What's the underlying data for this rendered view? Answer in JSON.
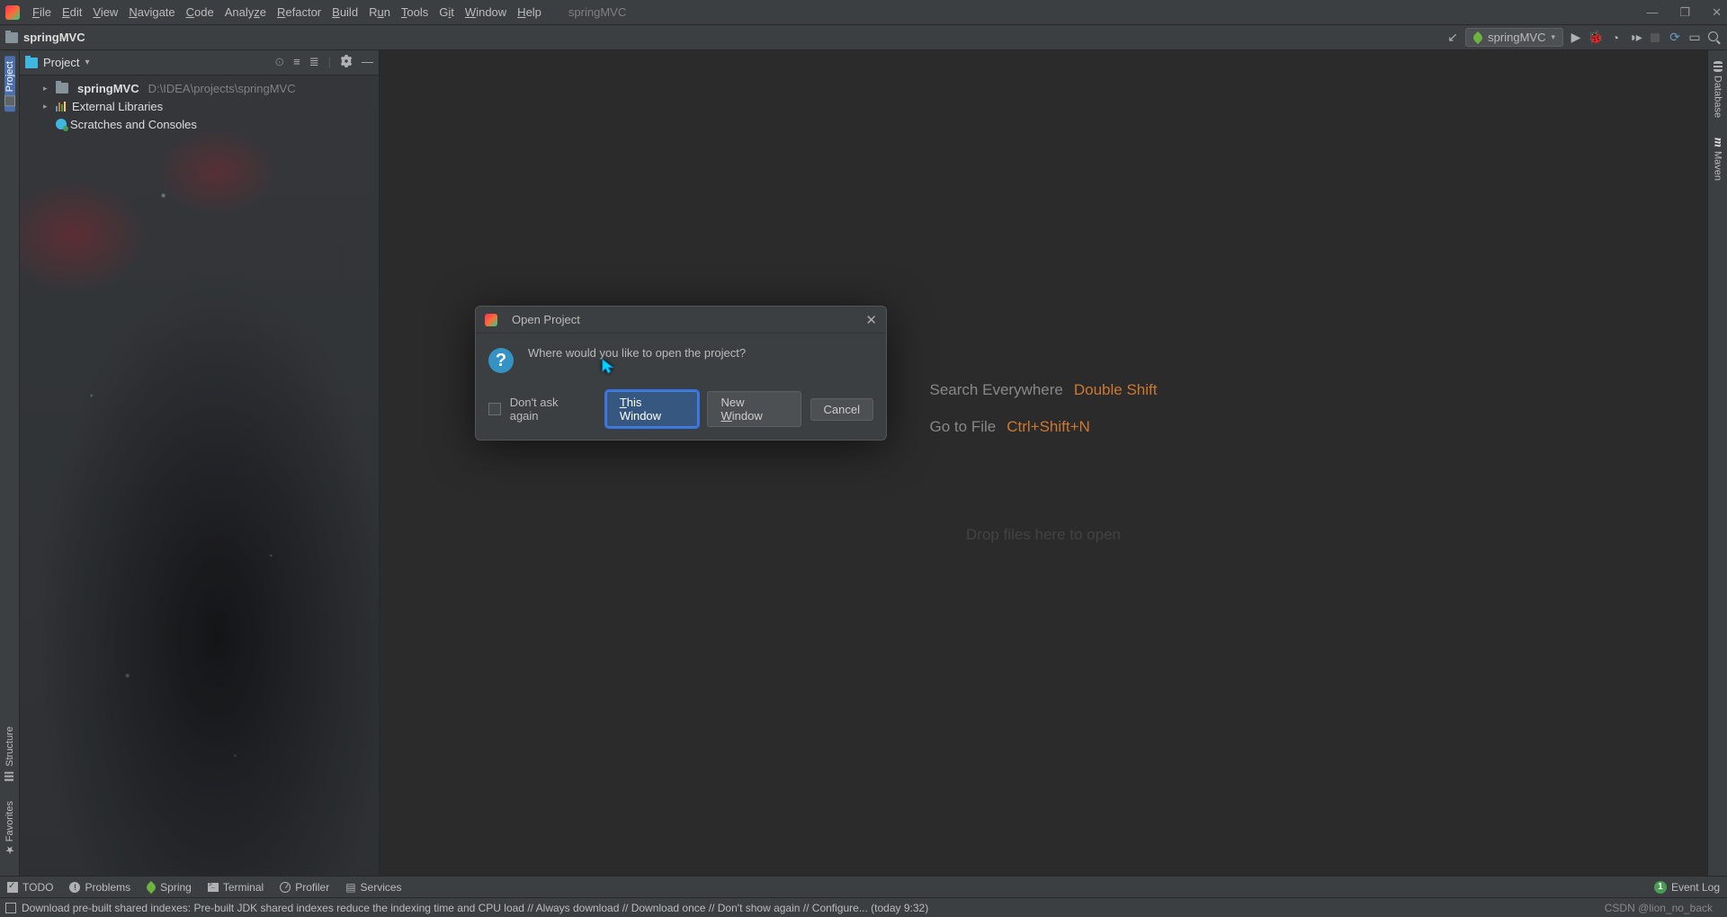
{
  "menubar": {
    "items": [
      "File",
      "Edit",
      "View",
      "Navigate",
      "Code",
      "Analyze",
      "Refactor",
      "Build",
      "Run",
      "Tools",
      "Git",
      "Window",
      "Help"
    ],
    "title": "springMVC"
  },
  "toolbar": {
    "project": "springMVC",
    "runConfig": "springMVC"
  },
  "sidebar": {
    "title": "Project",
    "tree": {
      "root": {
        "name": "springMVC",
        "path": "D:\\IDEA\\projects\\springMVC"
      },
      "external": "External Libraries",
      "scratches": "Scratches and Consoles"
    }
  },
  "leftTabs": {
    "project": "Project",
    "structure": "Structure",
    "favorites": "Favorites"
  },
  "rightTabs": {
    "database": "Database",
    "maven": "Maven"
  },
  "editor": {
    "hints": [
      {
        "label": "Search Everywhere",
        "shortcut": "Double Shift"
      },
      {
        "label": "Go to File",
        "shortcut": "Ctrl+Shift+N"
      }
    ],
    "dropHint": "Drop files here to open"
  },
  "dialog": {
    "title": "Open Project",
    "message": "Where would you like to open the project?",
    "checkbox": "Don't ask again",
    "buttons": {
      "thisWindow": "This Window",
      "newWindow": "New Window",
      "cancel": "Cancel"
    }
  },
  "bottombar": {
    "todo": "TODO",
    "problems": "Problems",
    "spring": "Spring",
    "terminal": "Terminal",
    "profiler": "Profiler",
    "services": "Services",
    "eventLog": "Event Log"
  },
  "statusbar": {
    "message": "Download pre-built shared indexes: Pre-built JDK shared indexes reduce the indexing time and CPU load // Always download // Download once // Don't show again // Configure... (today 9:32)",
    "watermark": "CSDN @lion_no_back"
  }
}
